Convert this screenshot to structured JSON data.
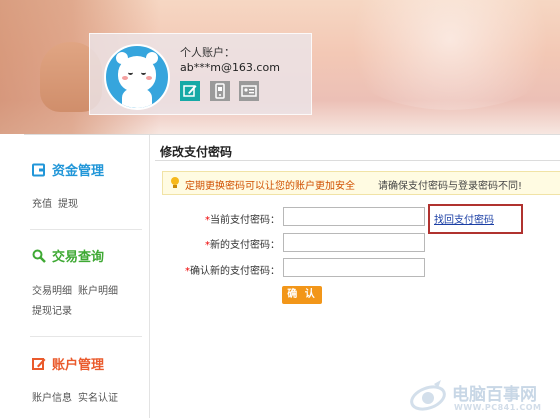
{
  "account": {
    "label": "个人账户：",
    "email": "ab***m@163.com",
    "icons": [
      "edit-icon",
      "phone-icon",
      "id-card-icon"
    ]
  },
  "sidebar": {
    "sections": [
      {
        "title": "资金管理",
        "icon": "wallet-icon",
        "color": "#2196d8",
        "links": [
          "充值",
          "提现"
        ]
      },
      {
        "title": "交易查询",
        "icon": "search-icon",
        "color": "#3fa934",
        "links": [
          "交易明细",
          "账户明细",
          "提现记录"
        ]
      },
      {
        "title": "账户管理",
        "icon": "edit-icon",
        "color": "#ea5a2c",
        "links": [
          "账户信息",
          "实名认证"
        ]
      }
    ]
  },
  "main": {
    "title": "修改支付密码",
    "tip": {
      "icon": "lightbulb-icon",
      "warning": "定期更换密码可以让您的账户更加安全",
      "note": "请确保支付密码与登录密码不同!"
    },
    "fields": [
      {
        "label": "当前支付密码：",
        "required": "*",
        "value": ""
      },
      {
        "label": "新的支付密码：",
        "required": "*",
        "value": ""
      },
      {
        "label": "确认新的支付密码：",
        "required": "*",
        "value": ""
      }
    ],
    "retrieve_link": "找回支付密码",
    "confirm_button": "确 认"
  },
  "watermark": {
    "name": "电脑百事网",
    "url": "WWW.PC841.COM"
  },
  "colors": {
    "accent_orange": "#f29619",
    "highlight_red": "#b0322f",
    "link_blue": "#1b3fa5",
    "warning_text": "#d05000"
  }
}
